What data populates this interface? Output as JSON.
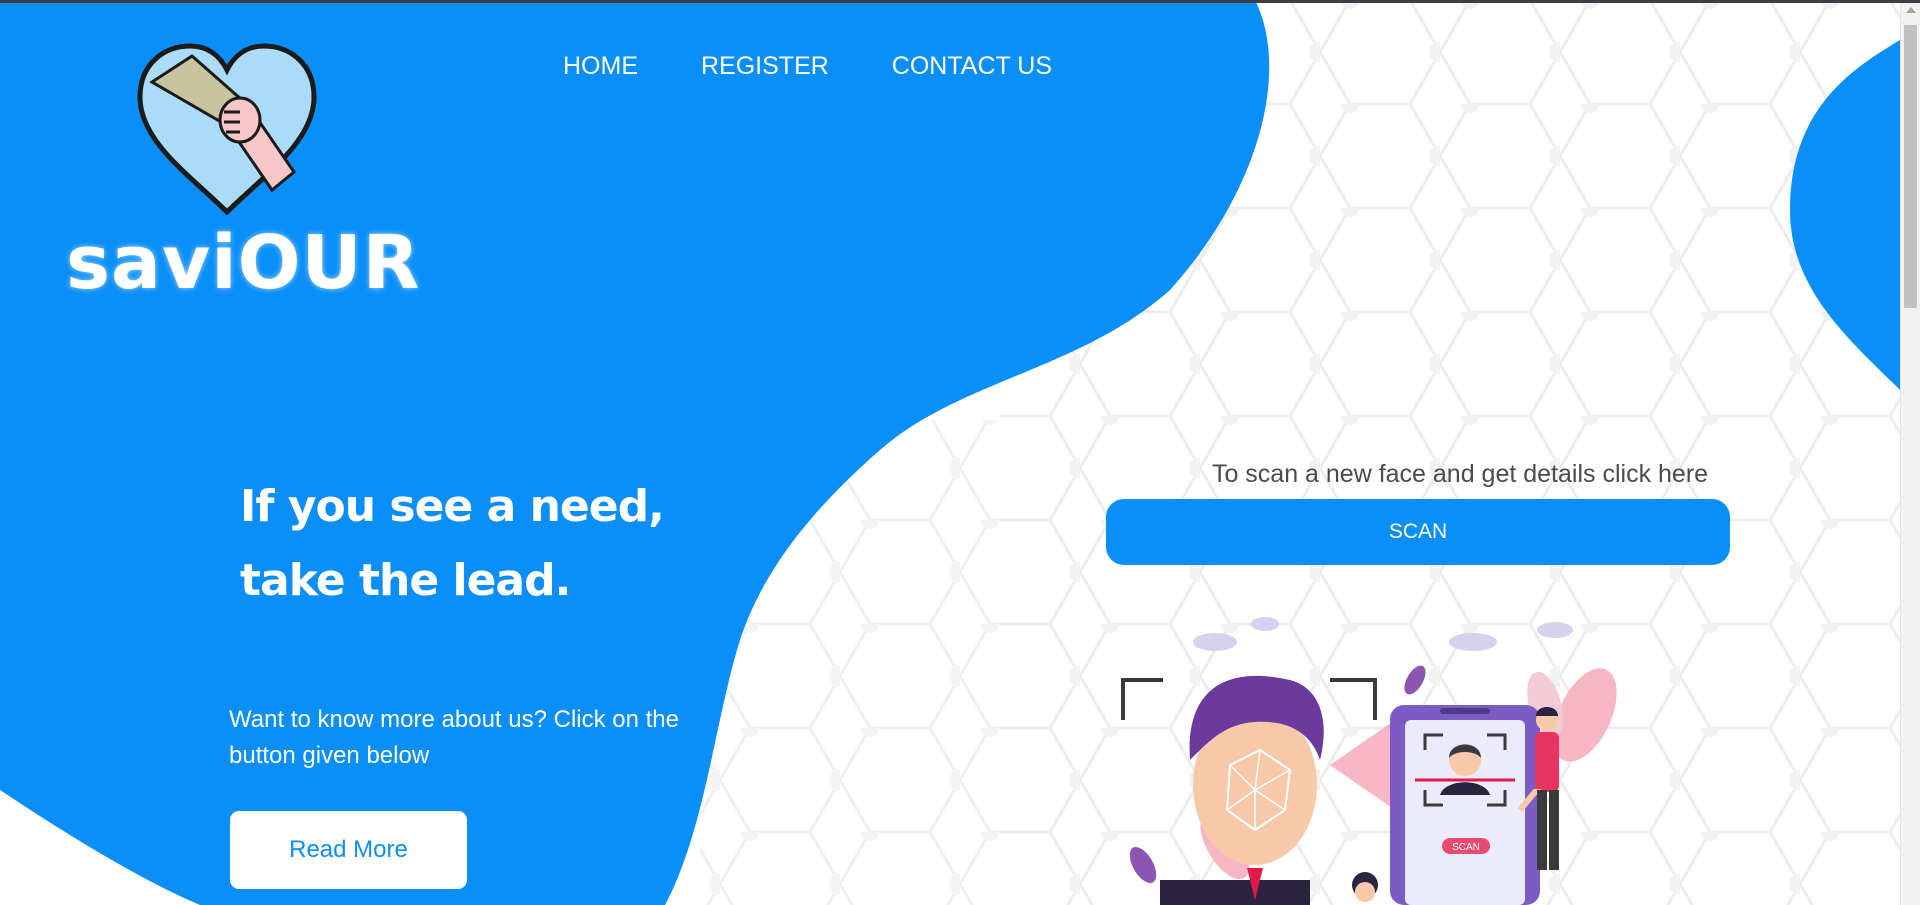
{
  "brand": {
    "name": "saviOUR"
  },
  "nav": {
    "items": [
      {
        "label": "HOME"
      },
      {
        "label": "REGISTER"
      },
      {
        "label": "CONTACT US"
      }
    ]
  },
  "hero": {
    "headline_line1": "If you see a need,",
    "headline_line2": "take the lead.",
    "subtext": "Want to know more about us? Click on the button given below",
    "read_more_label": "Read More"
  },
  "scan": {
    "caption": "To scan a new face and get details click here",
    "button_label": "SCAN",
    "phone_tag": "SCAN"
  },
  "colors": {
    "accent": "#0a8ef8",
    "text_dark": "#4b4b4b",
    "background": "#ffffff"
  },
  "icons": {
    "logo": "heart-handshake-icon",
    "illustration": "face-recognition-illustration"
  }
}
